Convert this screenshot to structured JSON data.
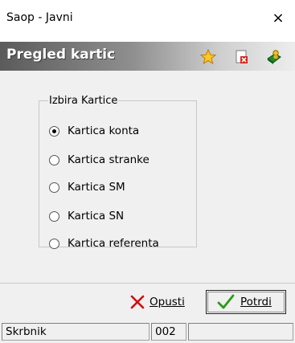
{
  "window": {
    "title": "Saop  - Javni",
    "close_glyph": "×"
  },
  "header": {
    "title": "Pregled kartic",
    "icons": [
      "star-icon",
      "document-delete-icon",
      "book-person-icon"
    ]
  },
  "group": {
    "legend": "Izbira Kartice",
    "options": [
      {
        "label": "Kartica konta",
        "checked": true
      },
      {
        "label": "Kartica stranke",
        "checked": false
      },
      {
        "label": "Kartica SM",
        "checked": false
      },
      {
        "label": "Kartica SN",
        "checked": false
      },
      {
        "label": "Kartica referenta",
        "checked": false
      }
    ]
  },
  "buttons": {
    "cancel_label": "Opusti",
    "confirm_label": "Potrdi"
  },
  "status": {
    "user": "Skrbnik",
    "code": "002",
    "extra": ""
  },
  "colors": {
    "cancel_x": "#d01010",
    "confirm_check": "#2a9a1a"
  }
}
